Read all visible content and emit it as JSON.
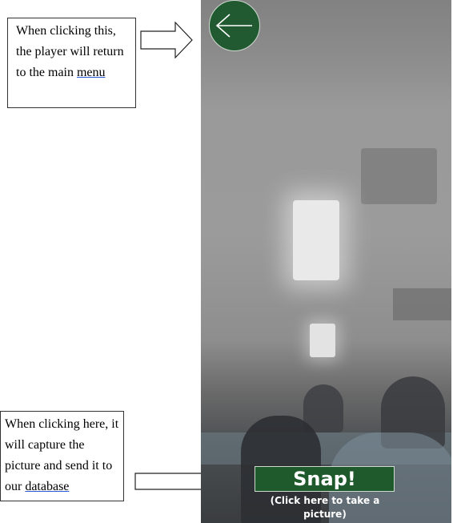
{
  "annotations": {
    "top_note": {
      "text": "When clicking this, the player will return to the main",
      "underlined": "menu"
    },
    "bottom_note": {
      "text": "When clicking here, it will capture the picture and send it to our",
      "underlined": "database"
    }
  },
  "screen": {
    "back_button": {
      "icon": "arrow-left-icon"
    },
    "snap_button": {
      "label": "Snap!"
    },
    "snap_hint": "(Click here to take a picture)",
    "colors": {
      "button_green": "#215a30",
      "hint_text": "#ffffff"
    }
  }
}
